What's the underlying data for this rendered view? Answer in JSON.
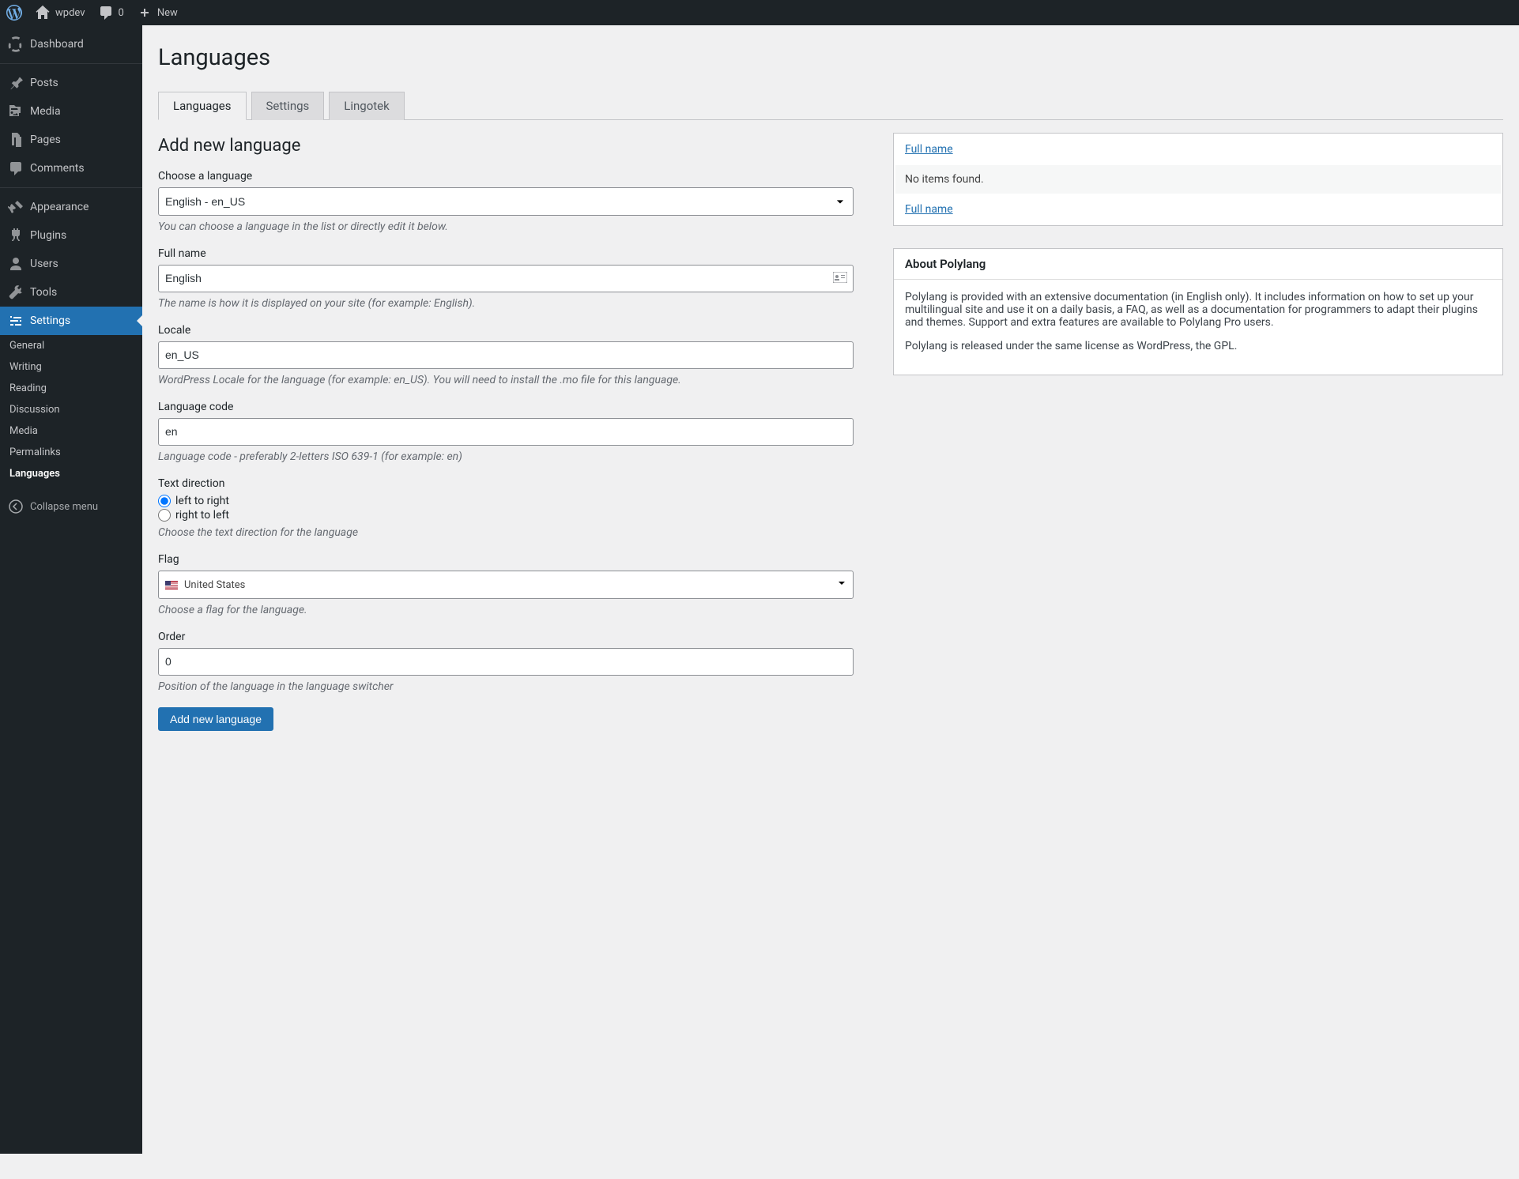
{
  "adminbar": {
    "site": "wpdev",
    "comments": "0",
    "new": "New"
  },
  "menu": {
    "dashboard": "Dashboard",
    "posts": "Posts",
    "media": "Media",
    "pages": "Pages",
    "comments": "Comments",
    "appearance": "Appearance",
    "plugins": "Plugins",
    "users": "Users",
    "tools": "Tools",
    "settings": "Settings",
    "collapse": "Collapse menu"
  },
  "submenu": {
    "general": "General",
    "writing": "Writing",
    "reading": "Reading",
    "discussion": "Discussion",
    "media": "Media",
    "permalinks": "Permalinks",
    "languages": "Languages"
  },
  "page": {
    "title": "Languages",
    "tabs": {
      "languages": "Languages",
      "settings": "Settings",
      "lingotek": "Lingotek"
    },
    "section": "Add new language",
    "choose_label": "Choose a language",
    "choose_value": "English - en_US",
    "choose_desc": "You can choose a language in the list or directly edit it below.",
    "fullname_label": "Full name",
    "fullname_value": "English",
    "fullname_desc": "The name is how it is displayed on your site (for example: English).",
    "locale_label": "Locale",
    "locale_value": "en_US",
    "locale_desc": "WordPress Locale for the language (for example: en_US). You will need to install the .mo file for this language.",
    "code_label": "Language code",
    "code_value": "en",
    "code_desc": "Language code - preferably 2-letters ISO 639-1 (for example: en)",
    "direction_label": "Text direction",
    "ltr": "left to right",
    "rtl": "right to left",
    "direction_desc": "Choose the text direction for the language",
    "flag_label": "Flag",
    "flag_value": "United States",
    "flag_desc": "Choose a flag for the language.",
    "order_label": "Order",
    "order_value": "0",
    "order_desc": "Position of the language in the language switcher",
    "submit": "Add new language"
  },
  "table": {
    "header": "Full name",
    "empty": "No items found.",
    "footer": "Full name"
  },
  "about": {
    "title": "About Polylang",
    "p1": "Polylang is provided with an extensive documentation (in English only). It includes information on how to set up your multilingual site and use it on a daily basis, a FAQ, as well as a documentation for programmers to adapt their plugins and themes. Support and extra features are available to Polylang Pro users.",
    "p2": "Polylang is released under the same license as WordPress, the GPL."
  }
}
